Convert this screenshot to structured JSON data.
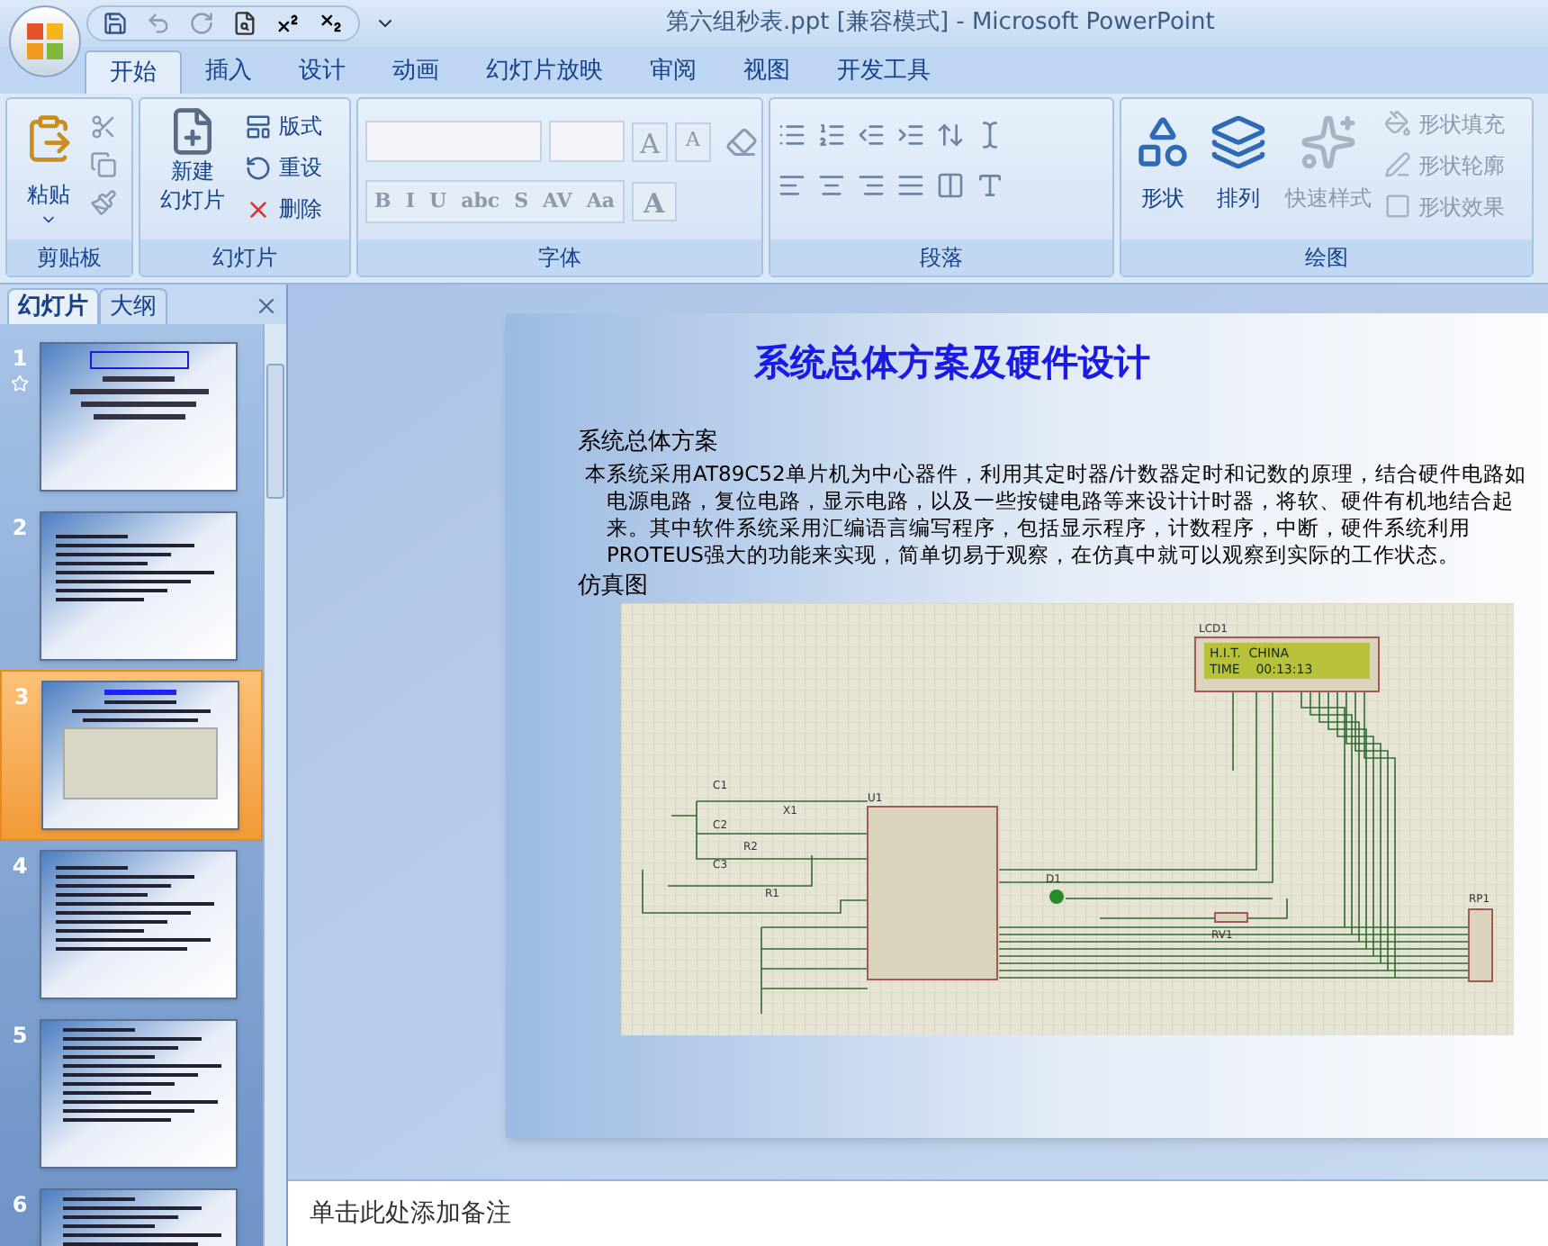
{
  "window": {
    "title": "第六组秒表.ppt [兼容模式] - Microsoft PowerPoint"
  },
  "tabs": [
    {
      "label": "开始",
      "selected": true
    },
    {
      "label": "插入",
      "selected": false
    },
    {
      "label": "设计",
      "selected": false
    },
    {
      "label": "动画",
      "selected": false
    },
    {
      "label": "幻灯片放映",
      "selected": false
    },
    {
      "label": "审阅",
      "selected": false
    },
    {
      "label": "视图",
      "selected": false
    },
    {
      "label": "开发工具",
      "selected": false
    }
  ],
  "ribbon": {
    "clipboard": {
      "label": "剪贴板",
      "paste": "粘贴"
    },
    "slides": {
      "label": "幻灯片",
      "new_slide": [
        "新建",
        "幻灯片"
      ],
      "items": [
        {
          "label": "版式",
          "kind": "layout"
        },
        {
          "label": "重设",
          "kind": "reset"
        },
        {
          "label": "删除",
          "kind": "delete"
        }
      ]
    },
    "font": {
      "label": "字体",
      "disabled": true,
      "size_buttons": [
        "A",
        "A"
      ],
      "format_buttons": [
        "B",
        "I",
        "U",
        "abc",
        "S",
        "AV",
        "Aa"
      ],
      "color_button": "A"
    },
    "paragraph": {
      "label": "段落"
    },
    "drawing": {
      "label": "绘图",
      "large": [
        {
          "label": "形状",
          "kind": "shapes",
          "disabled": false
        },
        {
          "label": "排列",
          "kind": "arrange",
          "disabled": false
        },
        {
          "label": "快速样式",
          "kind": "styles",
          "disabled": true
        }
      ],
      "items": [
        {
          "label": "形状填充",
          "kind": "fill",
          "disabled": true
        },
        {
          "label": "形状轮廓",
          "kind": "outline",
          "disabled": true
        },
        {
          "label": "形状效果",
          "kind": "effects",
          "disabled": true
        }
      ]
    }
  },
  "panel": {
    "tabs": [
      {
        "label": "幻灯片",
        "selected": true
      },
      {
        "label": "大纲",
        "selected": false
      }
    ],
    "slides": [
      {
        "number": "1",
        "kind": "title",
        "selected": false
      },
      {
        "number": "2",
        "kind": "text",
        "selected": false
      },
      {
        "number": "3",
        "kind": "diagram",
        "selected": true
      },
      {
        "number": "4",
        "kind": "list",
        "selected": false
      },
      {
        "number": "5",
        "kind": "code",
        "selected": false
      },
      {
        "number": "6",
        "kind": "code",
        "selected": false
      }
    ]
  },
  "slide": {
    "title": "系统总体方案及硬件设计",
    "heading": "系统总体方案",
    "paragraph": "本系统采用AT89C52单片机为中心器件，利用其定时器/计数器定时和记数的原理，结合硬件电路如电源电路，复位电路，显示电路，以及一些按键电路等来设计计时器，将软、硬件有机地结合起来。其中软件系统采用汇编语言编写程序，包括显示程序，计数程序，中断，硬件系统利用PROTEUS强大的功能来实现，简单切易于观察，在仿真中就可以观察到实际的工作状态。",
    "figure_heading": "仿真图",
    "circuit": {
      "lcd_label": "LCD1",
      "lcd_lines": [
        "H.I.T.  CHINA",
        "TIME    00:13:13"
      ],
      "labels": [
        "C1",
        "C2",
        "X1",
        "C3",
        "R2",
        "R1",
        "U1",
        "D1",
        "RV1",
        "RP1"
      ]
    }
  },
  "notes": {
    "placeholder": "单击此处添加备注"
  }
}
